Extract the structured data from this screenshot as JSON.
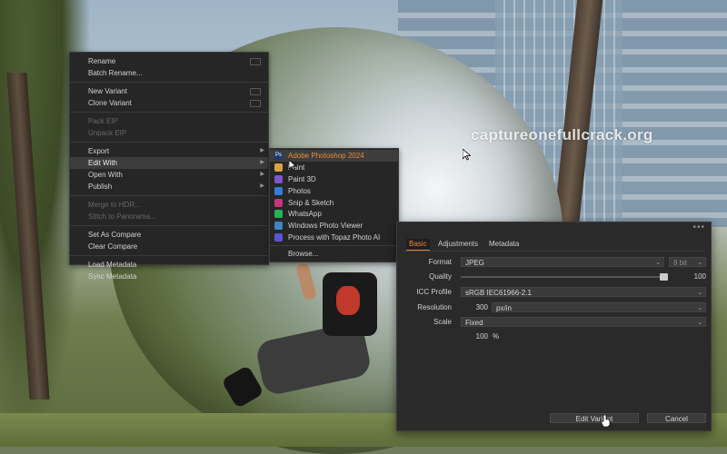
{
  "watermark": "captureonefullcrack.org",
  "context_menu": {
    "items": [
      {
        "label": "Rename",
        "disabled": false,
        "shortcut": true
      },
      {
        "label": "Batch Rename...",
        "disabled": false
      },
      {
        "sep": true
      },
      {
        "label": "New Variant",
        "disabled": false,
        "shortcut": true
      },
      {
        "label": "Clone Variant",
        "disabled": false,
        "shortcut": true
      },
      {
        "sep": true
      },
      {
        "label": "Pack EIP",
        "disabled": true
      },
      {
        "label": "Unpack EIP",
        "disabled": true
      },
      {
        "sep": true
      },
      {
        "label": "Export",
        "disabled": false,
        "submenu": true
      },
      {
        "label": "Edit With",
        "disabled": false,
        "submenu": true,
        "highlighted": true
      },
      {
        "label": "Open With",
        "disabled": false,
        "submenu": true
      },
      {
        "label": "Publish",
        "disabled": false,
        "submenu": true
      },
      {
        "sep": true
      },
      {
        "label": "Merge to HDR...",
        "disabled": true
      },
      {
        "label": "Stitch to Panorama...",
        "disabled": true
      },
      {
        "sep": true
      },
      {
        "label": "Set As Compare",
        "disabled": false
      },
      {
        "label": "Clear Compare",
        "disabled": false
      },
      {
        "sep": true
      },
      {
        "label": "Load Metadata",
        "disabled": false
      },
      {
        "label": "Sync Metadata",
        "disabled": false
      }
    ]
  },
  "edit_with_submenu": {
    "items": [
      {
        "label": "Adobe Photoshop 2024",
        "icon": "photoshop-icon",
        "icon_text": "Ps",
        "color": "#1f3a6b",
        "highlighted": true
      },
      {
        "label": "Paint",
        "icon": "paint-icon",
        "icon_text": "",
        "color": "#d9a441"
      },
      {
        "label": "Paint 3D",
        "icon": "paint3d-icon",
        "icon_text": "",
        "color": "#7b57c9"
      },
      {
        "label": "Photos",
        "icon": "photos-icon",
        "icon_text": "",
        "color": "#2f7fd6"
      },
      {
        "label": "Snip & Sketch",
        "icon": "snip-icon",
        "icon_text": "",
        "color": "#c8357c"
      },
      {
        "label": "WhatsApp",
        "icon": "whatsapp-icon",
        "icon_text": "",
        "color": "#25b35a"
      },
      {
        "label": "Windows Photo Viewer",
        "icon": "photo-viewer-icon",
        "icon_text": "",
        "color": "#3c86c9"
      },
      {
        "label": "Process with Topaz Photo AI",
        "icon": "topaz-icon",
        "icon_text": "",
        "color": "#5a53d6"
      },
      {
        "label": "Browse...",
        "icon": "",
        "icon_text": "",
        "color": "",
        "sep_before": true
      }
    ]
  },
  "dialog": {
    "dots": "•••",
    "tabs": [
      "Basic",
      "Adjustments",
      "Metadata"
    ],
    "active_tab": "Basic",
    "format_label": "Format",
    "format_value": "JPEG",
    "bit_value": "8 bit",
    "quality_label": "Quality",
    "quality_value": "100",
    "quality_level": 1.0,
    "icc_label": "ICC Profile",
    "icc_value": "sRGB IEC61966-2.1",
    "resolution_label": "Resolution",
    "resolution_value": "300",
    "resolution_unit": "px/in",
    "scale_label": "Scale",
    "scale_value": "Fixed",
    "scale_percent": "100",
    "percent_sign": "%",
    "edit_variant_label": "Edit Variant",
    "cancel_label": "Cancel"
  },
  "colors": {
    "accent": "#e98a3b",
    "panel": "#262626"
  }
}
